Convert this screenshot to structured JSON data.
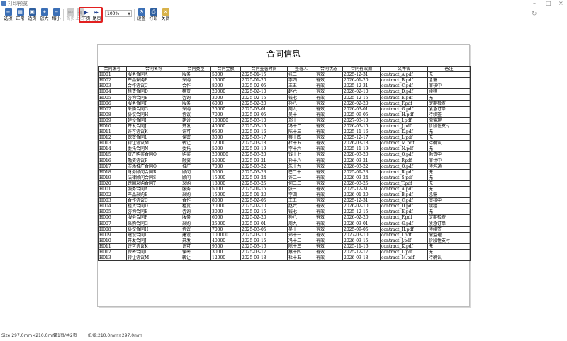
{
  "window": {
    "title": "打印预览"
  },
  "toolbar": {
    "buttons": [
      {
        "label": "选项",
        "icon": "options-icon"
      },
      {
        "label": "正常",
        "icon": "normal-view-icon"
      },
      {
        "label": "适页",
        "icon": "fit-page-icon"
      },
      {
        "label": "放大",
        "icon": "zoom-in-icon"
      },
      {
        "label": "缩小",
        "icon": "zoom-out-icon"
      },
      {
        "label": "首页",
        "icon": "first-page-icon"
      },
      {
        "label": "上页",
        "icon": "prev-page-icon"
      },
      {
        "label": "下页",
        "icon": "next-page-icon"
      },
      {
        "label": "尾页",
        "icon": "last-page-icon"
      },
      {
        "label": "设置",
        "icon": "page-setup-icon"
      },
      {
        "label": "打印",
        "icon": "printer-icon"
      },
      {
        "label": "关闭",
        "icon": "close-icon"
      }
    ],
    "zoom": "100%"
  },
  "document": {
    "title": "合同信息",
    "columns": [
      "合同编号",
      "合同名称",
      "合同类型",
      "合同金额",
      "合同签署时间",
      "签署人",
      "合同状态",
      "合同有效期",
      "文件名",
      "备注"
    ],
    "rows": [
      [
        "H001",
        "服务合同A",
        "服务",
        "5000",
        "2025-01-15",
        "张三",
        "有效",
        "2025-12-31",
        "contract_A.pdf",
        "无"
      ],
      [
        "H002",
        "产品采购B",
        "采购",
        "15000",
        "2025-01-20",
        "李四",
        "有效",
        "2026-01-20",
        "contract_B.pdf",
        "急需"
      ],
      [
        "H003",
        "合作协议C",
        "合作",
        "8000",
        "2025-02-05",
        "王五",
        "有效",
        "2025-12-31",
        "contract_C.pdf",
        "审核中"
      ],
      [
        "H004",
        "租赁合同D",
        "租赁",
        "20000",
        "2025-02-10",
        "赵六",
        "有效",
        "2026-02-10",
        "contract_D.pdf",
        "续租"
      ],
      [
        "H005",
        "咨询合同E",
        "咨询",
        "3000",
        "2025-02-15",
        "钱七",
        "有效",
        "2025-12-15",
        "contract_E.pdf",
        "无"
      ],
      [
        "H006",
        "服务合同F",
        "服务",
        "6000",
        "2025-02-20",
        "孙八",
        "有效",
        "2026-02-20",
        "contract_F.pdf",
        "定期检查"
      ],
      [
        "H007",
        "采购合同G",
        "采购",
        "25000",
        "2025-03-01",
        "周九",
        "有效",
        "2026-03-01",
        "contract_G.pdf",
        "紧急订单"
      ],
      [
        "H008",
        "协议合同H",
        "协议",
        "7000",
        "2025-03-05",
        "吴十",
        "有效",
        "2025-09-05",
        "contract_H.pdf",
        "待续签"
      ],
      [
        "H009",
        "建设合同I",
        "建设",
        "100000",
        "2025-03-10",
        "郑十一",
        "有效",
        "2027-03-10",
        "contract_I.pdf",
        "需监理"
      ],
      [
        "H010",
        "开发合同J",
        "开发",
        "40000",
        "2025-03-15",
        "冯十二",
        "有效",
        "2026-03-15",
        "contract_J.pdf",
        "阶段性支付"
      ],
      [
        "H011",
        "许可协议K",
        "许可",
        "9500",
        "2025-03-16",
        "陈十三",
        "有效",
        "2025-11-16",
        "contract_K.pdf",
        "无"
      ],
      [
        "H012",
        "保密合同L",
        "保密",
        "3000",
        "2025-03-17",
        "蔡十四",
        "有效",
        "2025-12-17",
        "contract_L.pdf",
        "无"
      ],
      [
        "H013",
        "转让协议M",
        "转让",
        "12000",
        "2025-03-18",
        "杜十五",
        "有效",
        "2026-03-18",
        "contract_M.pdf",
        "待确认"
      ],
      [
        "H014",
        "委托合同N",
        "委托",
        "5000",
        "2025-03-19",
        "李十六",
        "有效",
        "2025-11-19",
        "contract_N.pdf",
        "无"
      ],
      [
        "H015",
        "资产购买合同O",
        "购买",
        "200000",
        "2025-03-20",
        "钱十七",
        "有效",
        "2028-03-20",
        "contract_O.pdf",
        "融资中"
      ],
      [
        "H016",
        "融资协议P",
        "融资",
        "50000",
        "2025-03-21",
        "孙十八",
        "有效",
        "2026-03-21",
        "contract_P.pdf",
        "审计中"
      ],
      [
        "H017",
        "市场推广合同Q",
        "推广",
        "7000",
        "2025-03-22",
        "朱十九",
        "有效",
        "2026-03-22",
        "contract_Q.pdf",
        "待沟通"
      ],
      [
        "H018",
        "财务顾问合同R",
        "顾问",
        "5000",
        "2025-03-23",
        "巴二十",
        "有效",
        "2025-09-23",
        "contract_R.pdf",
        "无"
      ],
      [
        "H019",
        "法律顾问合同S",
        "顾问",
        "15000",
        "2025-03-24",
        "许二一",
        "有效",
        "2026-03-24",
        "contract_S.pdf",
        "无"
      ],
      [
        "H020",
        "跨国采购合同T",
        "采购",
        "18000",
        "2025-03-25",
        "何二二",
        "有效",
        "2026-03-25",
        "contract_T.pdf",
        "无"
      ],
      [
        "H001",
        "服务合同A",
        "服务",
        "5000",
        "2025-01-15",
        "张三",
        "有效",
        "2025-12-31",
        "contract_A.pdf",
        "无"
      ],
      [
        "H002",
        "产品采购B",
        "采购",
        "15000",
        "2025-01-20",
        "李四",
        "有效",
        "2026-01-20",
        "contract_B.pdf",
        "急需"
      ],
      [
        "H003",
        "合作协议C",
        "合作",
        "8000",
        "2025-02-05",
        "王五",
        "有效",
        "2025-12-31",
        "contract_C.pdf",
        "审核中"
      ],
      [
        "H004",
        "租赁合同D",
        "租赁",
        "20000",
        "2025-02-10",
        "赵六",
        "有效",
        "2026-02-10",
        "contract_D.pdf",
        "续租"
      ],
      [
        "H005",
        "咨询合同E",
        "咨询",
        "3000",
        "2025-02-15",
        "钱七",
        "有效",
        "2025-12-15",
        "contract_E.pdf",
        "无"
      ],
      [
        "H006",
        "服务合同F",
        "服务",
        "6000",
        "2025-02-20",
        "孙八",
        "有效",
        "2026-02-20",
        "contract_F.pdf",
        "定期检查"
      ],
      [
        "H007",
        "采购合同G",
        "采购",
        "25000",
        "2025-03-01",
        "周九",
        "有效",
        "2026-03-01",
        "contract_G.pdf",
        "紧急订单"
      ],
      [
        "H008",
        "协议合同H",
        "协议",
        "7000",
        "2025-03-05",
        "吴十",
        "有效",
        "2025-09-05",
        "contract_H.pdf",
        "待续签"
      ],
      [
        "H009",
        "建设合同I",
        "建设",
        "100000",
        "2025-03-10",
        "郑十一",
        "有效",
        "2027-03-10",
        "contract_I.pdf",
        "需监理"
      ],
      [
        "H010",
        "开发合同J",
        "开发",
        "40000",
        "2025-03-15",
        "冯十二",
        "有效",
        "2026-03-15",
        "contract_J.pdf",
        "阶段性支付"
      ],
      [
        "H011",
        "许可协议K",
        "许可",
        "9500",
        "2025-03-16",
        "陈十三",
        "有效",
        "2025-11-16",
        "contract_K.pdf",
        "无"
      ],
      [
        "H012",
        "保密合同L",
        "保密",
        "3000",
        "2025-03-17",
        "蔡十四",
        "有效",
        "2025-12-17",
        "contract_L.pdf",
        "无"
      ],
      [
        "H013",
        "转让协议M",
        "转让",
        "12000",
        "2025-03-18",
        "杜十五",
        "有效",
        "2026-03-18",
        "contract_M.pdf",
        "待确认"
      ]
    ]
  },
  "status": {
    "size": "Size:297.0mm×210.0mm",
    "page": "第1页/共2页",
    "paper": "纸张:210.0mm×297.0mm"
  },
  "colors": {
    "highlight": "#e22020",
    "icon_blue": "#3b6fb6"
  }
}
